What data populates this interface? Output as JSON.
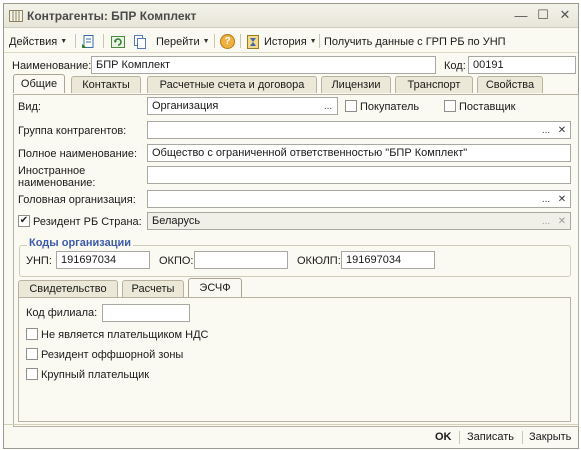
{
  "window": {
    "title": "Контрагенты: БПР Комплект",
    "minimize": "—",
    "maximize": "☐",
    "close": "✕"
  },
  "toolbar": {
    "actions": "Действия",
    "go": "Перейти",
    "help": "?",
    "history": "История",
    "fetch": "Получить данные с ГРП РБ по УНП"
  },
  "header": {
    "name_label": "Наименование:",
    "name_value": "БПР Комплект",
    "code_label": "Код:",
    "code_value": "00191"
  },
  "main_tabs": [
    "Общие",
    "Контакты",
    "Расчетные счета и договора",
    "Лицензии",
    "Транспорт",
    "Свойства"
  ],
  "general": {
    "kind_label": "Вид:",
    "kind_value": "Организация",
    "buyer_label": "Покупатель",
    "supplier_label": "Поставщик",
    "group_label": "Группа контрагентов:",
    "group_value": "",
    "fullname_label": "Полное наименование:",
    "fullname_value": "Общество с ограниченной ответственностью \"БПР Комплект\"",
    "foreign_label_1": "Иностранное",
    "foreign_label_2": "наименование:",
    "foreign_value": "",
    "head_label": "Головная организация:",
    "head_value": "",
    "resident_label": "Резидент РБ Страна:",
    "resident_checked": true,
    "country_value": "Беларусь"
  },
  "codes": {
    "title": "Коды организации",
    "unp_label": "УНП:",
    "unp_value": "191697034",
    "okpo_label": "ОКПО:",
    "okpo_value": "",
    "okulp_label": "ОКЮЛП:",
    "okulp_value": "191697034"
  },
  "sub_tabs": [
    "Свидетельство",
    "Расчеты",
    "ЭСЧФ"
  ],
  "esf": {
    "branch_label": "Код филиала:",
    "branch_value": "",
    "not_vat_label": "Не является плательщиком НДС",
    "offshore_label": "Резидент оффшорной зоны",
    "large_label": "Крупный плательщик"
  },
  "footer": {
    "ok": "OK",
    "save": "Записать",
    "close": "Закрыть"
  },
  "icons": {
    "ellipsis": "...",
    "clear": "✕"
  }
}
